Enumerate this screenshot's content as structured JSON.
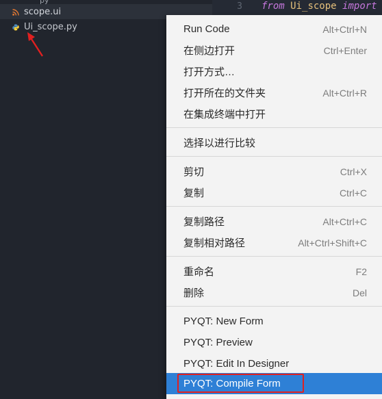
{
  "explorer": {
    "clipped_top": "py",
    "files": [
      {
        "name": "scope.ui",
        "icon": "rss-icon",
        "color": "#e37933",
        "selected": true
      },
      {
        "name": "Ui_scope.py",
        "icon": "python-icon",
        "color": "#4b8bbe",
        "selected": false
      }
    ]
  },
  "editor": {
    "line_number": "3",
    "code": {
      "kw1": "from",
      "module": "Ui_scope",
      "kw2": "import"
    }
  },
  "menu": {
    "groups": [
      [
        {
          "label": "Run Code",
          "shortcut": "Alt+Ctrl+N"
        },
        {
          "label": "在侧边打开",
          "shortcut": "Ctrl+Enter"
        },
        {
          "label": "打开方式…",
          "shortcut": ""
        },
        {
          "label": "打开所在的文件夹",
          "shortcut": "Alt+Ctrl+R"
        },
        {
          "label": "在集成终端中打开",
          "shortcut": ""
        }
      ],
      [
        {
          "label": "选择以进行比较",
          "shortcut": ""
        }
      ],
      [
        {
          "label": "剪切",
          "shortcut": "Ctrl+X"
        },
        {
          "label": "复制",
          "shortcut": "Ctrl+C"
        }
      ],
      [
        {
          "label": "复制路径",
          "shortcut": "Alt+Ctrl+C"
        },
        {
          "label": "复制相对路径",
          "shortcut": "Alt+Ctrl+Shift+C"
        }
      ],
      [
        {
          "label": "重命名",
          "shortcut": "F2"
        },
        {
          "label": "删除",
          "shortcut": "Del"
        }
      ],
      [
        {
          "label": "PYQT: New Form",
          "shortcut": ""
        },
        {
          "label": "PYQT: Preview",
          "shortcut": ""
        },
        {
          "label": "PYQT: Edit In Designer",
          "shortcut": ""
        },
        {
          "label": "PYQT: Compile Form",
          "shortcut": "",
          "highlighted": true
        }
      ]
    ]
  },
  "colors": {
    "highlight": "#2e80d6",
    "annotation": "#e02020"
  }
}
